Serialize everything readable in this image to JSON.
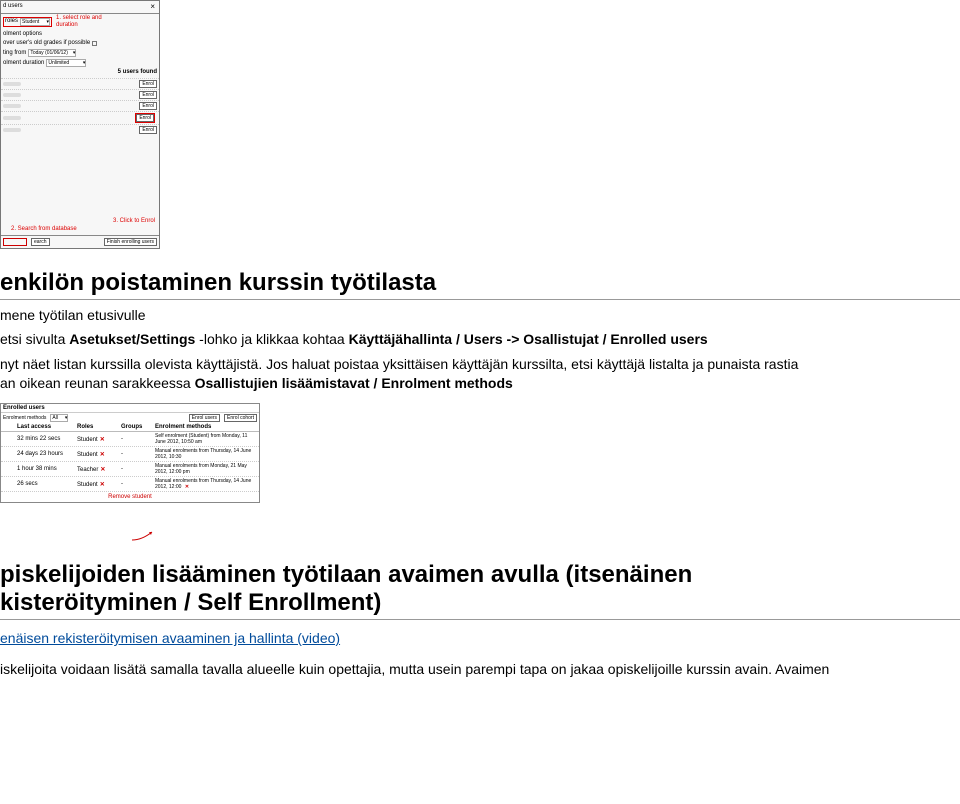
{
  "dialog": {
    "title": "d users",
    "roles_label": "roles",
    "roles_value": "Student",
    "annot1": "1. select role and duration",
    "opt_header": "olment options",
    "opt_recover": "over user's old grades if possible",
    "opt_starting": "ting from",
    "opt_starting_val": "Today (01/06/12)",
    "opt_duration": "olment duration",
    "opt_duration_val": "Unlimited",
    "found": "5 users found",
    "enrol_btn": "Enrol",
    "annot2": "2. Search from database",
    "annot3": "3. Click to Enrol",
    "search_btn": "earch",
    "finish_btn": "Finish enrolling users"
  },
  "section1": {
    "title": "enkilön poistaminen kurssin työtilasta",
    "p1": "mene työtilan etusivulle",
    "p2a": "etsi sivulta ",
    "p2b": "Asetukset/Settings",
    "p2c": " -lohko ja klikkaa kohtaa ",
    "p2d": "Käyttäjähallinta / Users -> Osallistujat / Enrolled users",
    "p3a": "nyt näet listan kurssilla olevista käyttäjistä. Jos haluat poistaa yksittäisen käyttäjän kurssilta, etsi käyttäjä listalta ja punaista rastia",
    "p3b": "an oikean reunan sarakkeessa ",
    "p3c": "Osallistujien lisäämistavat / Enrolment methods"
  },
  "enrolled": {
    "title": "Enrolled users",
    "methods_label": "Enrolment methods",
    "methods_value": "All",
    "btn_enrol": "Enrol users",
    "btn_cohort": "Enrol cohort",
    "col_last": "Last access",
    "col_roles": "Roles",
    "col_groups": "Groups",
    "col_methods": "Enrolment methods",
    "rows": [
      {
        "last": "32 mins 22 secs",
        "role": "Student",
        "method": "Self enrolment (Student) from Monday, 11 June 2012, 10:50 am"
      },
      {
        "last": "24 days 23 hours",
        "role": "Student",
        "method": "Manual enrolments from Thursday, 14 June 2012, 10:30"
      },
      {
        "last": "1 hour 38 mins",
        "role": "Teacher",
        "method": "Manual enrolments from Monday, 21 May 2012, 12:00 pm"
      },
      {
        "last": "26 secs",
        "role": "Student",
        "method": "Manual enrolments from Thursday, 14 June 2012, 12:00"
      }
    ],
    "remove": "Remove student"
  },
  "section2": {
    "title1": "piskelijoiden lisääminen työtilaan avaimen avulla (itsenäinen",
    "title2": "kisteröityminen / Self Enrollment)",
    "link": "enäisen rekisteröitymisen avaaminen ja hallinta (video)",
    "p1": "iskelijoita voidaan lisätä samalla tavalla alueelle kuin opettajia, mutta usein parempi tapa on jakaa opiskelijoille kurssin avain. Avaimen"
  }
}
